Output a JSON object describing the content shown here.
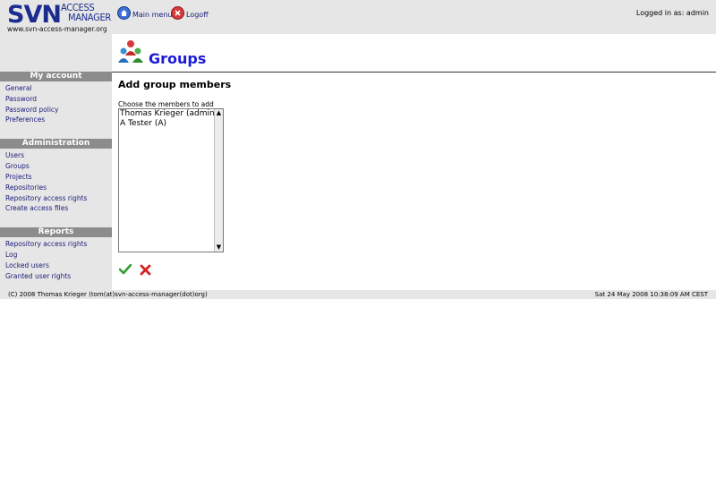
{
  "header": {
    "logo_main": "SVN",
    "logo_access": "ACCESS",
    "logo_manager": "MANAGER",
    "logo_url": "www.svn-access-manager.org",
    "nav": [
      {
        "label": "Main menu",
        "icon": "home-icon"
      },
      {
        "label": "Logoff",
        "icon": "logoff-icon"
      }
    ],
    "logged_in": "Logged in as: admin"
  },
  "sidebar": {
    "sections": [
      {
        "title": "My account",
        "items": [
          "General",
          "Password",
          "Password policy",
          "Preferences"
        ]
      },
      {
        "title": "Administration",
        "items": [
          "Users",
          "Groups",
          "Projects",
          "Repositories",
          "Repository access rights",
          "Create access files"
        ]
      },
      {
        "title": "Reports",
        "items": [
          "Repository access rights",
          "Log",
          "Locked users",
          "Granted user rights"
        ]
      }
    ]
  },
  "main": {
    "title": "Groups",
    "subtitle": "Add group members",
    "choose_label": "Choose the members to add",
    "members": [
      "Thomas Krieger (admin)",
      "A Tester (A)"
    ],
    "ok_icon": "checkmark-icon",
    "cancel_icon": "red-x-icon"
  },
  "footer": {
    "copyright": "(C) 2008 Thomas Krieger (tom(at)svn-access-manager(dot)org)",
    "date": "Sat 24 May 2008 10:38:09 AM CEST"
  },
  "colors": {
    "link": "#1a1a7a",
    "title": "#1b1bd6",
    "section_header": "#8c8c8c",
    "panel_bg": "#e6e6e6"
  }
}
